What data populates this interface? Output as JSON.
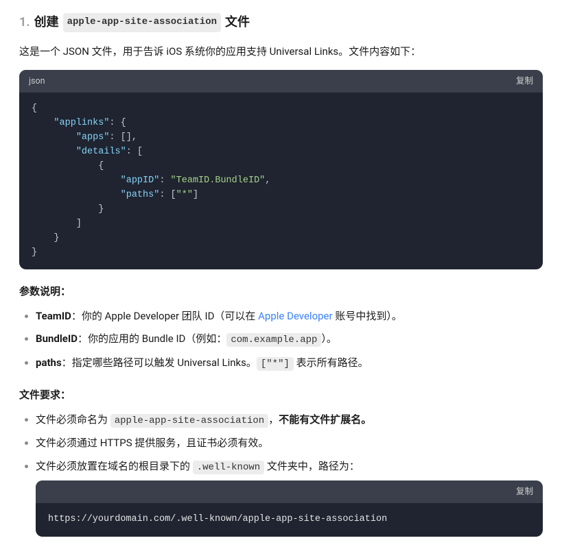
{
  "heading": {
    "step": "1.",
    "prefix": "创建",
    "code": "apple-app-site-association",
    "suffix": "文件"
  },
  "intro": "这是一个 JSON 文件，用于告诉 iOS 系统你的应用支持 Universal Links。文件内容如下：",
  "code1": {
    "lang": "json",
    "copy": "复制",
    "lines": {
      "l0": "{",
      "l1_key": "\"applinks\"",
      "l1_rest": ": {",
      "l2_key": "\"apps\"",
      "l2_rest": ": [],",
      "l3_key": "\"details\"",
      "l3_rest": ": [",
      "l4": "{",
      "l5_key": "\"appID\"",
      "l5_mid": ": ",
      "l5_val": "\"TeamID.BundleID\"",
      "l5_end": ",",
      "l6_key": "\"paths\"",
      "l6_mid": ": [",
      "l6_val": "\"*\"",
      "l6_end": "]",
      "l7": "}",
      "l8": "]",
      "l9": "}",
      "l10": "}"
    }
  },
  "params_title": "参数说明：",
  "params": {
    "p1_key": "TeamID",
    "p1_a": "：你的 Apple Developer 团队 ID（可以在 ",
    "p1_link": "Apple Developer",
    "p1_b": " 账号中找到）。",
    "p2_key": "BundleID",
    "p2_a": "：你的应用的 Bundle ID（例如：",
    "p2_code": "com.example.app",
    "p2_b": "）。",
    "p3_key": "paths",
    "p3_a": "：指定哪些路径可以触发 Universal Links。",
    "p3_code": "[\"*\"]",
    "p3_b": " 表示所有路径。"
  },
  "req_title": "文件要求：",
  "req": {
    "r1_a": "文件必须命名为 ",
    "r1_code": "apple-app-site-association",
    "r1_b": "，",
    "r1_strong": "不能有文件扩展名。",
    "r2": "文件必须通过 HTTPS 提供服务，且证书必须有效。",
    "r3_a": "文件必须放置在域名的根目录下的 ",
    "r3_code": ".well-known",
    "r3_b": " 文件夹中，路径为："
  },
  "code2": {
    "copy": "复制",
    "text": "https://yourdomain.com/.well-known/apple-app-site-association"
  }
}
